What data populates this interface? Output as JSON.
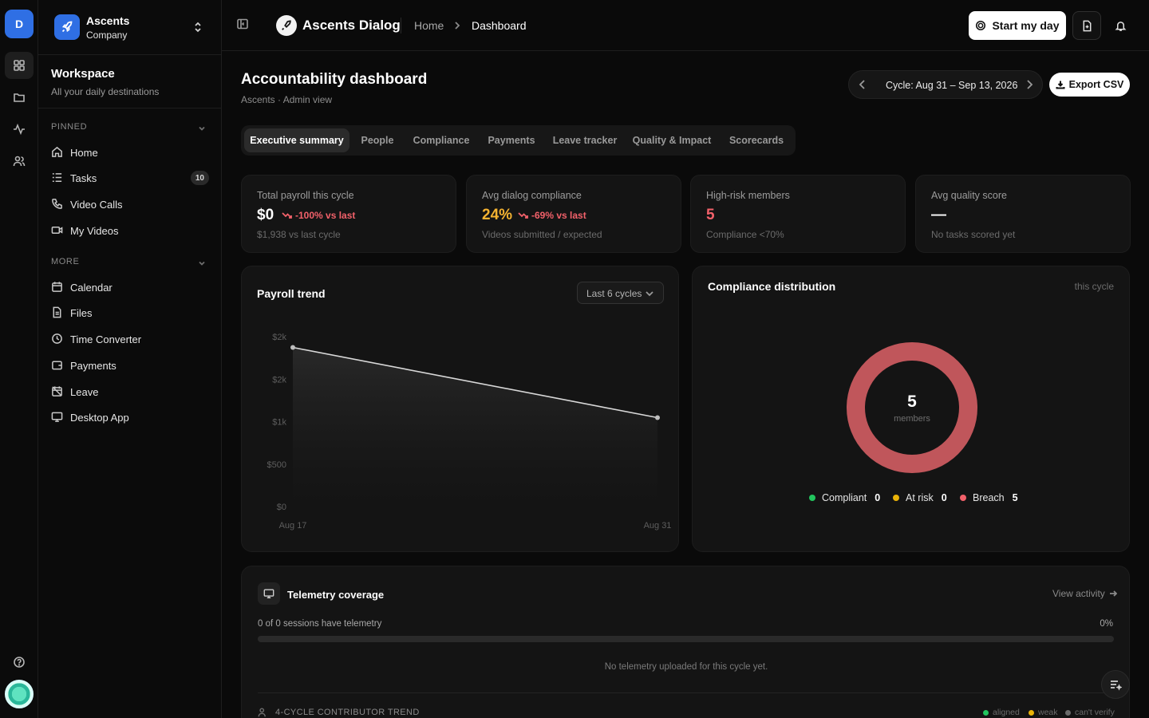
{
  "rail": {
    "workspace_initial": "D",
    "items": [
      {
        "icon": "grid-icon",
        "active": true
      },
      {
        "icon": "folder-icon",
        "active": false
      },
      {
        "icon": "activity-icon",
        "active": false
      },
      {
        "icon": "users-icon",
        "active": false
      }
    ],
    "bottom": [
      "help-icon",
      "user-avatar"
    ]
  },
  "org": {
    "name": "Ascents",
    "sub": "Company"
  },
  "workspace": {
    "title": "Workspace",
    "subtitle": "All your daily destinations"
  },
  "sidebar": {
    "pinned_label": "PINNED",
    "pinned": [
      {
        "label": "Home",
        "icon": "home-icon"
      },
      {
        "label": "Tasks",
        "icon": "tasks-icon",
        "badge": "10"
      },
      {
        "label": "Video Calls",
        "icon": "phone-icon"
      },
      {
        "label": "My Videos",
        "icon": "video-icon"
      }
    ],
    "more_label": "MORE",
    "more": [
      {
        "label": "Calendar",
        "icon": "calendar-icon"
      },
      {
        "label": "Files",
        "icon": "file-icon"
      },
      {
        "label": "Time Converter",
        "icon": "clock-icon"
      },
      {
        "label": "Payments",
        "icon": "wallet-icon"
      },
      {
        "label": "Leave",
        "icon": "calendar-off-icon"
      },
      {
        "label": "Desktop App",
        "icon": "monitor-icon"
      }
    ]
  },
  "topbar": {
    "app_name": "Ascents Dialog",
    "breadcrumb": [
      "Home",
      "Dashboard"
    ],
    "start_label": "Start my day"
  },
  "page": {
    "title": "Accountability dashboard",
    "subtitle": "Ascents · Admin view",
    "cycle": "Cycle: Aug 31 – Sep 13, 2026",
    "export_label": "Export CSV"
  },
  "tabs": [
    "Executive summary",
    "People",
    "Compliance",
    "Payments",
    "Leave tracker",
    "Quality & Impact",
    "Scorecards"
  ],
  "active_tab": 0,
  "stats": [
    {
      "label": "Total payroll this cycle",
      "value": "$0",
      "delta": "-100% vs last",
      "foot": "$1,938 vs last cycle",
      "value_color": "#ffffff"
    },
    {
      "label": "Avg dialog compliance",
      "value": "24%",
      "delta": "-69% vs last",
      "foot": "Videos submitted / expected",
      "value_color": "#f5b331"
    },
    {
      "label": "High-risk members",
      "value": "5",
      "delta": "",
      "foot": "Compliance <70%",
      "value_color": "#f2616a"
    },
    {
      "label": "Avg quality score",
      "value": "—",
      "delta": "",
      "foot": "No tasks scored yet",
      "value_color": "#ffffff"
    }
  ],
  "payroll": {
    "title": "Payroll trend",
    "range": "Last 6 cycles"
  },
  "compliance": {
    "title": "Compliance distribution",
    "note": "this cycle",
    "total": "5",
    "total_label": "members",
    "legend": [
      {
        "label": "Compliant",
        "count": "0",
        "color": "#22c55e"
      },
      {
        "label": "At risk",
        "count": "0",
        "color": "#eab308"
      },
      {
        "label": "Breach",
        "count": "5",
        "color": "#f2616a"
      }
    ]
  },
  "telemetry": {
    "title": "Telemetry coverage",
    "link": "View activity",
    "sessions": "0 of 0 sessions have telemetry",
    "percent": "0%",
    "fraction": 0,
    "empty": "No telemetry uploaded for this cycle yet.",
    "trend_label": "4-CYCLE CONTRIBUTOR TREND",
    "trend_legend": [
      {
        "label": "aligned",
        "color": "#22c55e"
      },
      {
        "label": "weak",
        "color": "#eab308"
      },
      {
        "label": "can't verify",
        "color": "#6b6b6b"
      }
    ]
  },
  "chart_data": {
    "type": "area",
    "x": [
      "Aug 17",
      "Aug 31"
    ],
    "values": [
      1938,
      1100
    ],
    "ytick_labels": [
      "$2k",
      "$2k",
      "$1k",
      "$500",
      "$0"
    ],
    "ylim": [
      0,
      2000
    ],
    "grid": false,
    "line_color": "#d8d8d8"
  }
}
